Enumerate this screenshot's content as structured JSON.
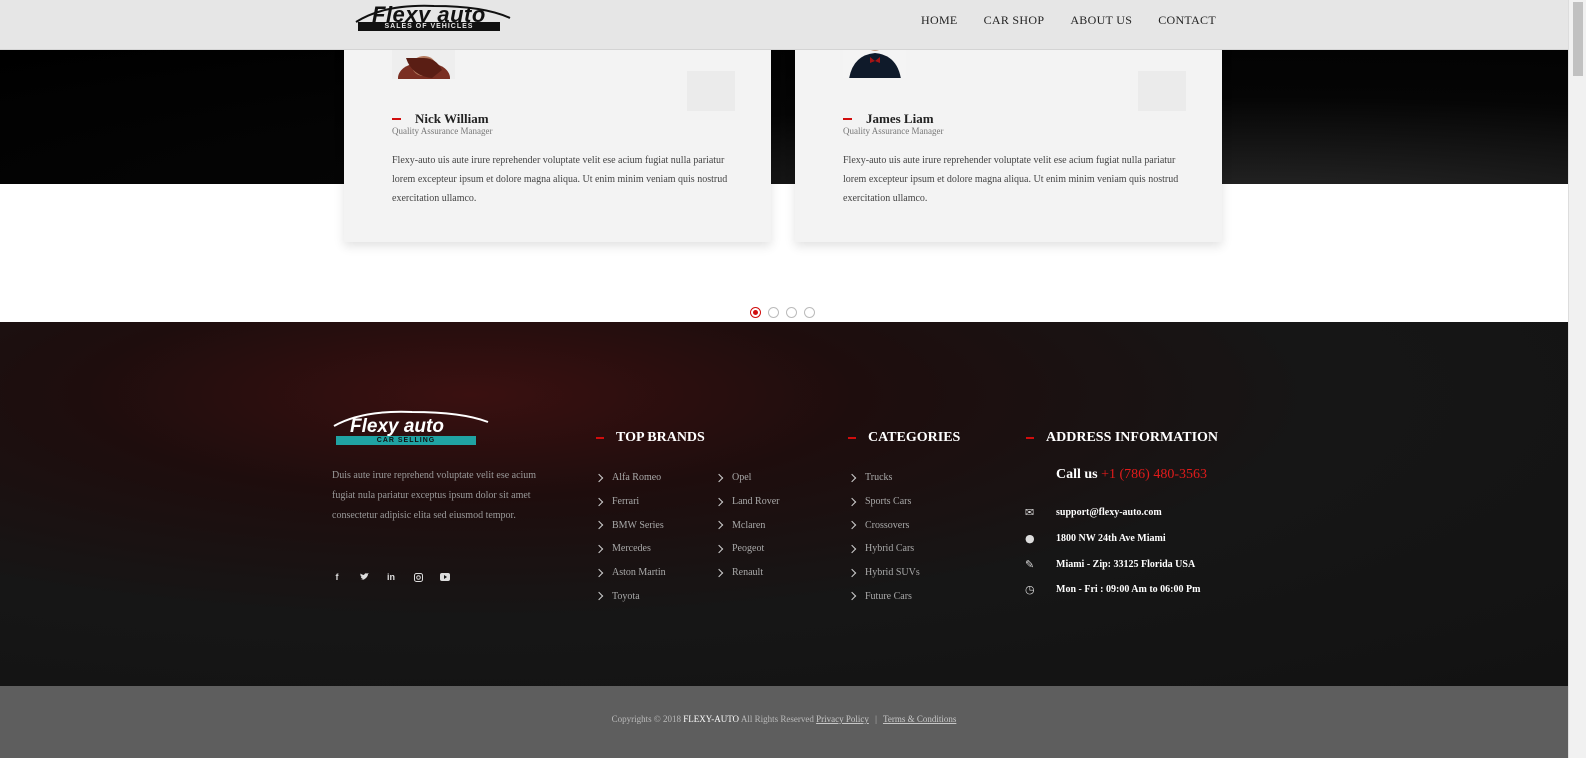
{
  "header": {
    "logo_text": "Flexy auto",
    "logo_sub": "SALES OF VEHICLES",
    "nav": [
      "HOME",
      "CAR SHOP",
      "ABOUT US",
      "CONTACT"
    ]
  },
  "testimonials": [
    {
      "name": "Nick William",
      "role": "Quality Assurance Manager",
      "text": "Flexy-auto uis aute irure reprehender voluptate velit ese acium fugiat nulla pariatur lorem excepteur ipsum et dolore magna aliqua. Ut enim minim veniam quis nostrud exercitation ullamco."
    },
    {
      "name": "James Liam",
      "role": "Quality Assurance Manager",
      "text": "Flexy-auto uis aute irure reprehender voluptate velit ese acium fugiat nulla pariatur lorem excepteur ipsum et dolore magna aliqua. Ut enim minim veniam quis nostrud exercitation ullamco."
    }
  ],
  "carousel": {
    "dot_count": 4,
    "active_index": 0
  },
  "footer": {
    "logo_text": "Flexy auto",
    "logo_sub": "CAR SELLING",
    "about": "Duis aute irure reprehend voluptate velit ese acium fugiat nula pariatur exceptus ipsum dolor sit amet consectetur adipisic elita sed eiusmod tempor.",
    "social_icons": [
      "facebook-icon",
      "twitter-icon",
      "linkedin-icon",
      "instagram-icon",
      "youtube-icon"
    ],
    "top_brands_title": "TOP BRANDS",
    "brands_col1": [
      "Alfa Romeo",
      "Ferrari",
      "BMW Series",
      "Mercedes",
      "Aston Martin",
      "Toyota"
    ],
    "brands_col2": [
      "Opel",
      "Land Rover",
      "Mclaren",
      "Peogeot",
      "Renault"
    ],
    "categories_title": "CATEGORIES",
    "categories": [
      "Trucks",
      "Sports Cars",
      "Crossovers",
      "Hybrid Cars",
      "Hybrid SUVs",
      "Future Cars"
    ],
    "address_title": "ADDRESS INFORMATION",
    "call_label": "Call us",
    "phone": "+1 (786) 480-3563",
    "email": "support@flexy-auto.com",
    "street": "1800 NW 24th Ave Miami",
    "city": "Miami - Zip: 33125 Florida USA",
    "hours": "Mon - Fri : 09:00 Am to 06:00 Pm"
  },
  "copyright": {
    "prefix": "Copyrights © 2018",
    "brand": "FLEXY-AUTO",
    "suffix": "All Rights Reserved",
    "privacy": "Privacy Policy",
    "separator": "|",
    "terms": "Terms & Conditions"
  },
  "colors": {
    "accent": "#d10d0d",
    "header_bg": "#e6e6e6",
    "footer_bg": "#161616",
    "copyright_bg": "#5e5e5e"
  }
}
